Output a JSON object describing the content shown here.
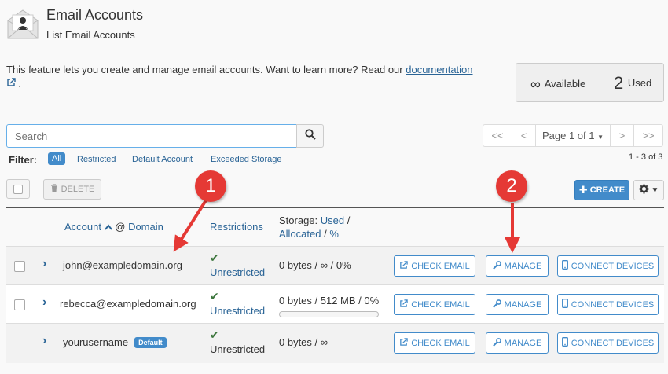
{
  "header": {
    "title": "Email Accounts",
    "subtitle": "List Email Accounts",
    "icon": "envelope-user-icon"
  },
  "intro": {
    "text": "This feature lets you create and manage email accounts. Want to learn more? Read our ",
    "link_label": "documentation",
    "trailing": "."
  },
  "stats": {
    "available_value": "∞",
    "available_label": "Available",
    "used_value": "2",
    "used_label": "Used"
  },
  "search": {
    "placeholder": "Search"
  },
  "pagination": {
    "first": "<<",
    "prev": "<",
    "page_label": "Page 1 of 1",
    "next": ">",
    "last": ">>",
    "range": "1 - 3 of 3"
  },
  "filter": {
    "label": "Filter:",
    "options": [
      "All",
      "Restricted",
      "Default Account",
      "Exceeded Storage"
    ],
    "active": "All"
  },
  "toolbar": {
    "delete_label": "DELETE",
    "create_label": "CREATE"
  },
  "table": {
    "headers": {
      "account": "Account",
      "at": "@",
      "domain": "Domain",
      "restrictions": "Restrictions",
      "storage": "Storage:",
      "used": "Used",
      "slash": "/",
      "allocated": "Allocated",
      "slash2": "/",
      "percent": "%"
    },
    "rows": [
      {
        "email": "john@exampledomain.org",
        "restriction": "Unrestricted",
        "storage": "0 bytes / ∞ / 0%",
        "usage_percent": 0,
        "has_checkbox": true
      },
      {
        "email": "rebecca@exampledomain.org",
        "restriction": "Unrestricted",
        "storage": "0 bytes / 512 MB / 0%",
        "usage_percent": 0,
        "has_checkbox": true
      },
      {
        "email": "yourusername",
        "badge": "Default",
        "restriction": "Unrestricted",
        "storage": "0 bytes / ∞",
        "usage_percent": 0,
        "has_checkbox": false
      }
    ],
    "actions": {
      "check_email": "CHECK EMAIL",
      "manage": "MANAGE",
      "connect_devices": "CONNECT DEVICES"
    }
  },
  "callouts": [
    "1",
    "2"
  ],
  "colors": {
    "primary": "#428bca",
    "link": "#2a6496",
    "success": "#3c763d",
    "callout": "#e53935"
  }
}
